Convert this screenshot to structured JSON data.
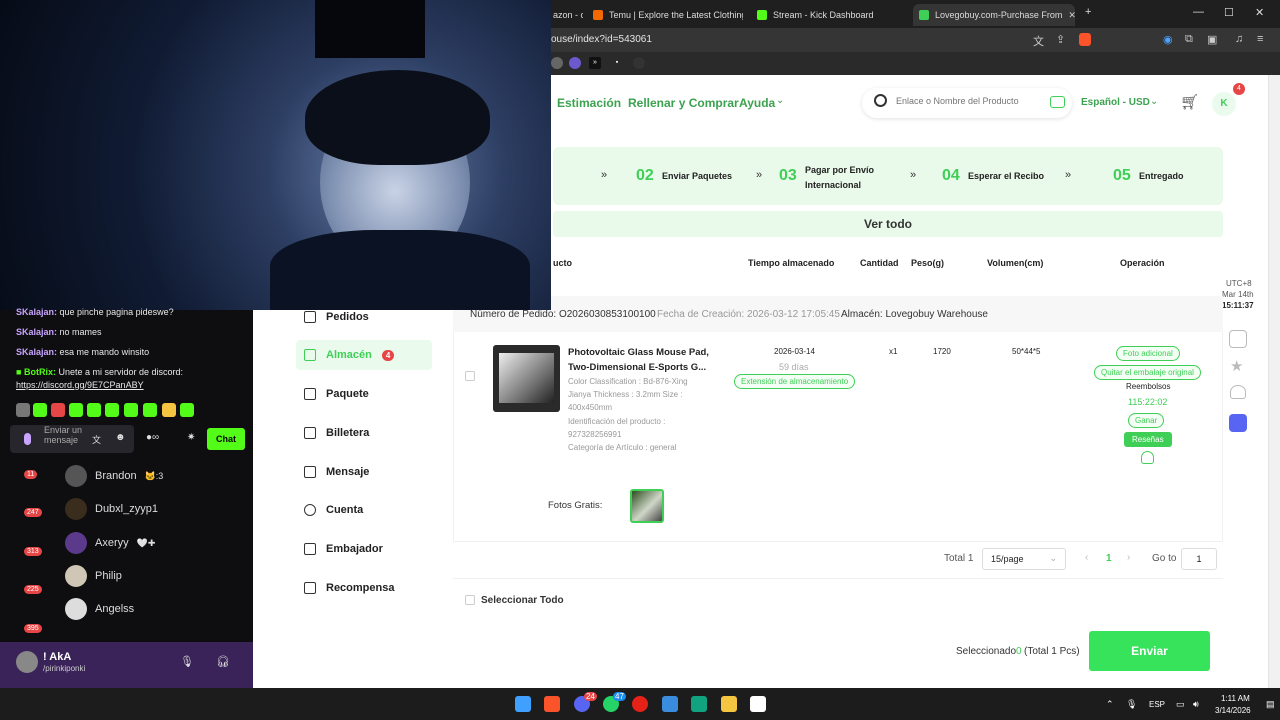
{
  "browser": {
    "tabs": [
      {
        "label": "azon - con",
        "color": "#888888"
      },
      {
        "label": "Temu | Explore the Latest Clothing, B",
        "color": "#f56a00"
      },
      {
        "label": "Stream - Kick Dashboard",
        "color": "#53fc18"
      },
      {
        "label": "Lovegobuy.com-Purchase From",
        "color": "#3fcf56"
      }
    ],
    "url": "ouse/index?id=543061"
  },
  "site": {
    "nav": [
      "Estimación",
      "Rellenar y Comprar",
      "Ayuda"
    ],
    "search_placeholder": "Enlace o Nombre del Producto",
    "language": "Español - USD",
    "avatar_letter": "K",
    "cart_badge": "4"
  },
  "steps": [
    {
      "num": "02",
      "label": "Enviar Paquetes"
    },
    {
      "num": "03",
      "label": "Pagar por Envío Internacional"
    },
    {
      "num": "04",
      "label": "Esperar el Recibo"
    },
    {
      "num": "05",
      "label": "Entregado"
    }
  ],
  "ver_todo": "Ver todo",
  "table_headers": [
    "ucto",
    "Tiempo almacenado",
    "Cantidad",
    "Peso(g)",
    "Volumen(cm)",
    "Operación"
  ],
  "clock": {
    "tz": "UTC+8",
    "date": "Mar 14th",
    "time": "15:11:37"
  },
  "sidebar": [
    {
      "label": "Pedidos",
      "badge": ""
    },
    {
      "label": "Almacén",
      "badge": "4"
    },
    {
      "label": "Paquete",
      "badge": ""
    },
    {
      "label": "Billetera",
      "badge": ""
    },
    {
      "label": "Mensaje",
      "badge": ""
    },
    {
      "label": "Cuenta",
      "badge": ""
    },
    {
      "label": "Embajador",
      "badge": ""
    },
    {
      "label": "Recompensa",
      "badge": ""
    }
  ],
  "order": {
    "number": "Número de Pedido: O2026030853100100",
    "created": "Fecha de Creación: 2026-03-12 17:05:45",
    "warehouse": "Almacén: Lovegobuy Warehouse",
    "product_title_1": "Photovoltaic Glass Mouse Pad,",
    "product_title_2": "Two-Dimensional E-Sports G...",
    "attr_1": "Color Classification : Bd-876-Xing",
    "attr_2": "Jianya Thickness : 3.2mm Size :",
    "attr_3": "400x450mm",
    "attr_4": "Identificación del producto :",
    "attr_5": "927328256991",
    "attr_6": "Categoría de Artículo : general",
    "stored_date": "2026-03-14",
    "stored_days": "59 días",
    "extension": "Extensión de almacenamiento",
    "quantity": "x1",
    "weight": "1720",
    "volume": "50*44*5",
    "op_photo": "Foto adicional",
    "op_remove_pack": "Quitar el embalaje original",
    "refund_label": "Reembolsos",
    "refund_timer": "115:22:02",
    "op_win": "Ganar",
    "op_reviews": "Reseñas",
    "free_photos": "Fotos Gratis:"
  },
  "pager": {
    "total": "Total 1",
    "per_page": "15/page",
    "current": "1",
    "goto_label": "Go to",
    "goto_value": "1"
  },
  "footer": {
    "select_all": "Seleccionar Todo",
    "selected_prefix": "Seleccionado",
    "selected_count": "0",
    "selected_suffix": "(Total 1 Pcs)",
    "submit": "Enviar"
  },
  "chat": {
    "lines": [
      {
        "user": "SKalajan:",
        "text": "que pinche pagina pideswe?"
      },
      {
        "user": "SKalajan:",
        "text": "no mames"
      },
      {
        "user": "SKalajan:",
        "text": "esa me mando winsito"
      },
      {
        "user": "BotRix:",
        "text": "Unete a mi servidor de discord:"
      }
    ],
    "link": "https://discord.gg/9E7CPanABY",
    "input_placeholder": "Enviar un mensaje",
    "send_label": "Chat"
  },
  "viewers": [
    {
      "name": "Brandon",
      "extra": "🐱:3",
      "count": "11"
    },
    {
      "name": "Dubxl_zyyp1",
      "extra": "",
      "count": "247"
    },
    {
      "name": "Axeryy",
      "extra": "🤍✚",
      "count": "313"
    },
    {
      "name": "Philip",
      "extra": "",
      "count": "225"
    },
    {
      "name": "Angelss",
      "extra": "",
      "count": "395"
    }
  ],
  "user_bar": {
    "name": "! AkA",
    "handle": "/pirinkiponki"
  },
  "taskbar": {
    "lang": "ESP",
    "time": "1:11 AM",
    "date": "3/14/2026",
    "badge_discord": "24",
    "badge_whatsapp": "47"
  }
}
